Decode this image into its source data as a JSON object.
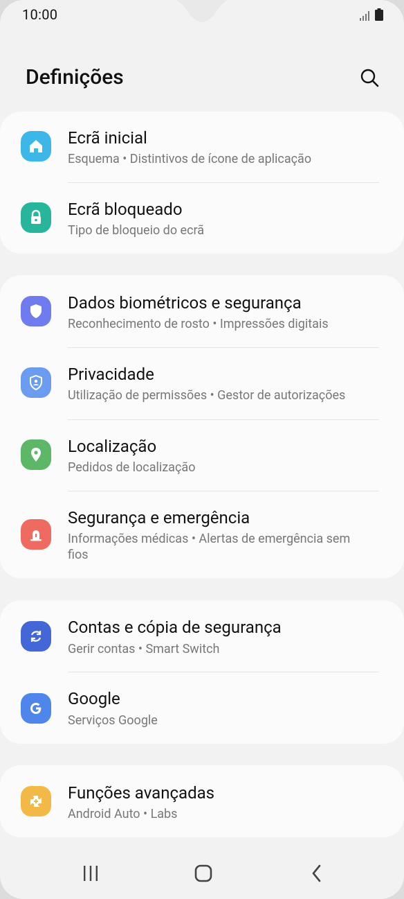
{
  "status_bar": {
    "time": "10:00"
  },
  "header": {
    "title": "Definições"
  },
  "sections": [
    [
      {
        "title": "Ecrã inicial",
        "subtitle": "Esquema • Distintivos de ícone de aplicação",
        "icon": "home-icon",
        "color": "#3cb7e8"
      },
      {
        "title": "Ecrã bloqueado",
        "subtitle": "Tipo de bloqueio do ecrã",
        "icon": "lock-icon",
        "color": "#27b59c"
      }
    ],
    [
      {
        "title": "Dados biométricos e segurança",
        "subtitle": "Reconhecimento de rosto • Impressões digitais",
        "icon": "shield-icon",
        "color": "#6f7bef"
      },
      {
        "title": "Privacidade",
        "subtitle": "Utilização de permissões • Gestor de autorizações",
        "icon": "privacy-shield-icon",
        "color": "#6c9cf0"
      },
      {
        "title": "Localização",
        "subtitle": "Pedidos de localização",
        "icon": "location-pin-icon",
        "color": "#5cb766"
      },
      {
        "title": "Segurança e emergência",
        "subtitle": "Informações médicas • Alertas de emergência sem fios",
        "icon": "emergency-alert-icon",
        "color": "#ef6b62"
      }
    ],
    [
      {
        "title": "Contas e cópia de segurança",
        "subtitle": "Gerir contas • Smart Switch",
        "icon": "sync-icon",
        "color": "#4467d8"
      },
      {
        "title": "Google",
        "subtitle": "Serviços Google",
        "icon": "google-icon",
        "color": "#4f86ec"
      }
    ],
    [
      {
        "title": "Funções avançadas",
        "subtitle": "Android Auto • Labs",
        "icon": "puzzle-plus-icon",
        "color": "#f3b947"
      }
    ]
  ],
  "nav": {
    "recent": "recent-apps-icon",
    "home": "home-button-icon",
    "back": "back-icon"
  }
}
